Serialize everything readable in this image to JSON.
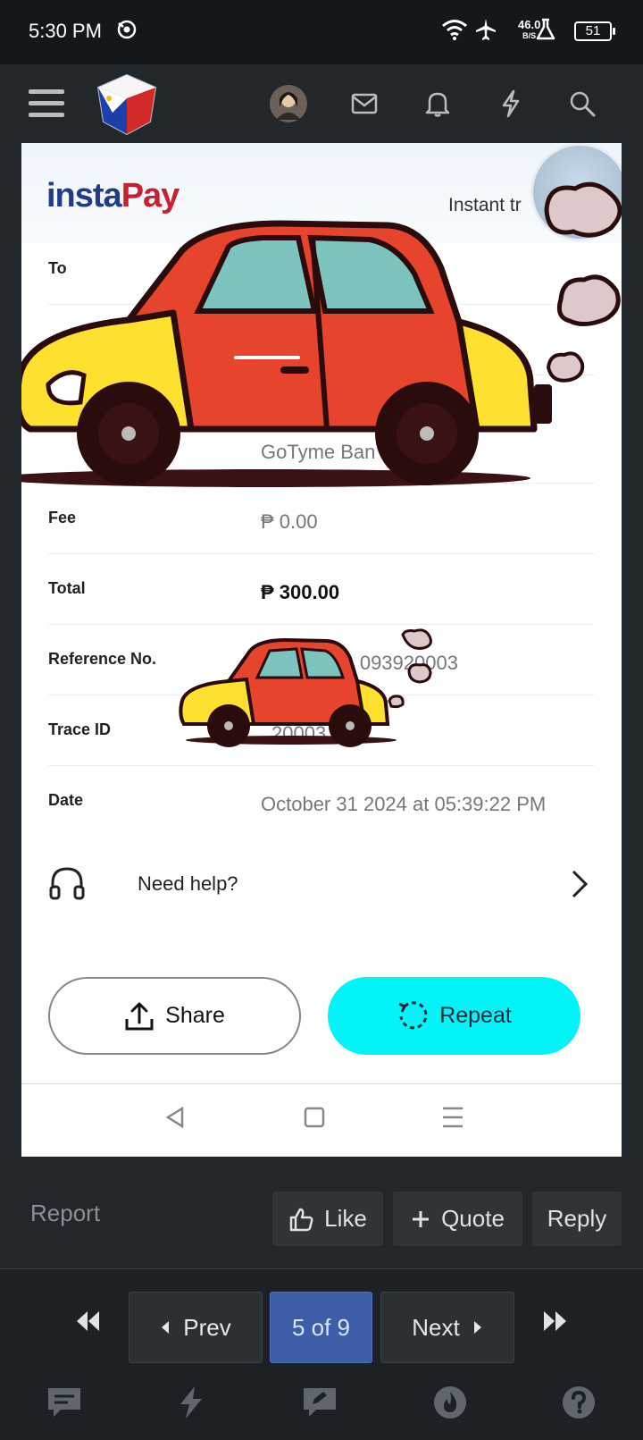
{
  "status_bar": {
    "time": "5:30 PM",
    "net_speed": "46.0",
    "net_unit": "B/S",
    "battery": "51",
    "icons": [
      "vpn-icon",
      "wifi-icon",
      "airplane-icon",
      "flask-icon",
      "battery-icon"
    ]
  },
  "nav": {
    "icons": [
      "hamburger-icon",
      "forum-logo",
      "avatar",
      "mail-icon",
      "bell-icon",
      "bolt-icon",
      "search-icon"
    ]
  },
  "receipt": {
    "brand_part1": "insta",
    "brand_part2": "Pay",
    "instant_label": "Instant tr",
    "rows": [
      {
        "label": "To",
        "value": ""
      },
      {
        "label": "",
        "value": "GoTyme Ban"
      },
      {
        "label": "Fee",
        "value": "₱ 0.00"
      },
      {
        "label": "Total",
        "value": "₱ 300.00"
      },
      {
        "label": "Reference No.",
        "value": "IT               093920003"
      },
      {
        "label": "Trace ID",
        "value": "20003"
      },
      {
        "label": "Date",
        "value": "October 31 2024 at 05:39:22 PM"
      }
    ],
    "help_label": "Need help?",
    "share_label": "Share",
    "repeat_label": "Repeat"
  },
  "post_actions": {
    "report": "Report",
    "like": "Like",
    "quote": "Quote",
    "reply": "Reply"
  },
  "pagination": {
    "prev": "Prev",
    "current": "5 of 9",
    "next": "Next"
  },
  "colors": {
    "accent_cyan": "#02f4f6",
    "brand_blue": "#1f3b8a",
    "brand_red": "#c8202f",
    "page_current": "#3d5da8"
  }
}
